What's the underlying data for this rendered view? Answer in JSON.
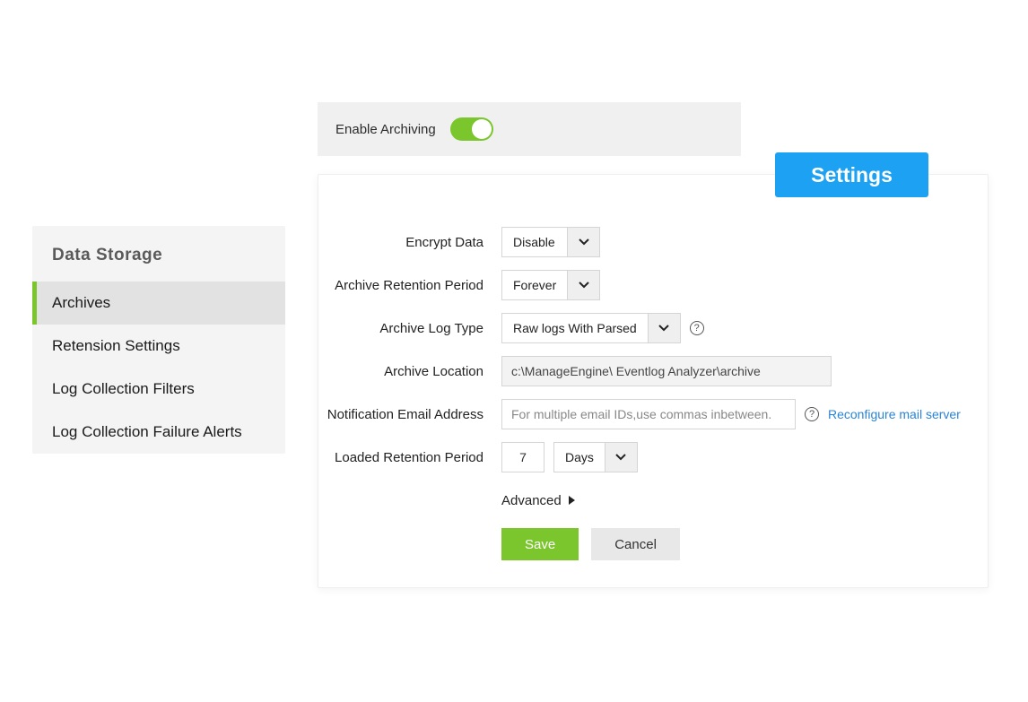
{
  "enable": {
    "label": "Enable Archiving",
    "on": true
  },
  "settings_tab": "Settings",
  "sidebar": {
    "title": "Data  Storage",
    "items": [
      {
        "label": "Archives",
        "active": true
      },
      {
        "label": "Retension Settings",
        "active": false
      },
      {
        "label": "Log Collection Filters",
        "active": false
      },
      {
        "label": "Log Collection Failure Alerts",
        "active": false
      }
    ]
  },
  "form": {
    "encryptData": {
      "label": "Encrypt Data",
      "value": "Disable"
    },
    "archiveRetention": {
      "label": "Archive Retention Period",
      "value": "Forever"
    },
    "archiveLogType": {
      "label": "Archive Log Type",
      "value": "Raw logs With Parsed"
    },
    "archiveLocation": {
      "label": "Archive Location",
      "value": "c:\\ManageEngine\\ Eventlog Analyzer\\archive"
    },
    "notificationEmail": {
      "label": "Notification Email Address",
      "placeholder": "For multiple email IDs,use commas inbetween."
    },
    "loadedRetention": {
      "label": "Loaded Retention Period",
      "value": "7",
      "unit": "Days"
    },
    "advanced": "Advanced",
    "reconfigure": "Reconfigure mail server",
    "save": "Save",
    "cancel": "Cancel"
  }
}
